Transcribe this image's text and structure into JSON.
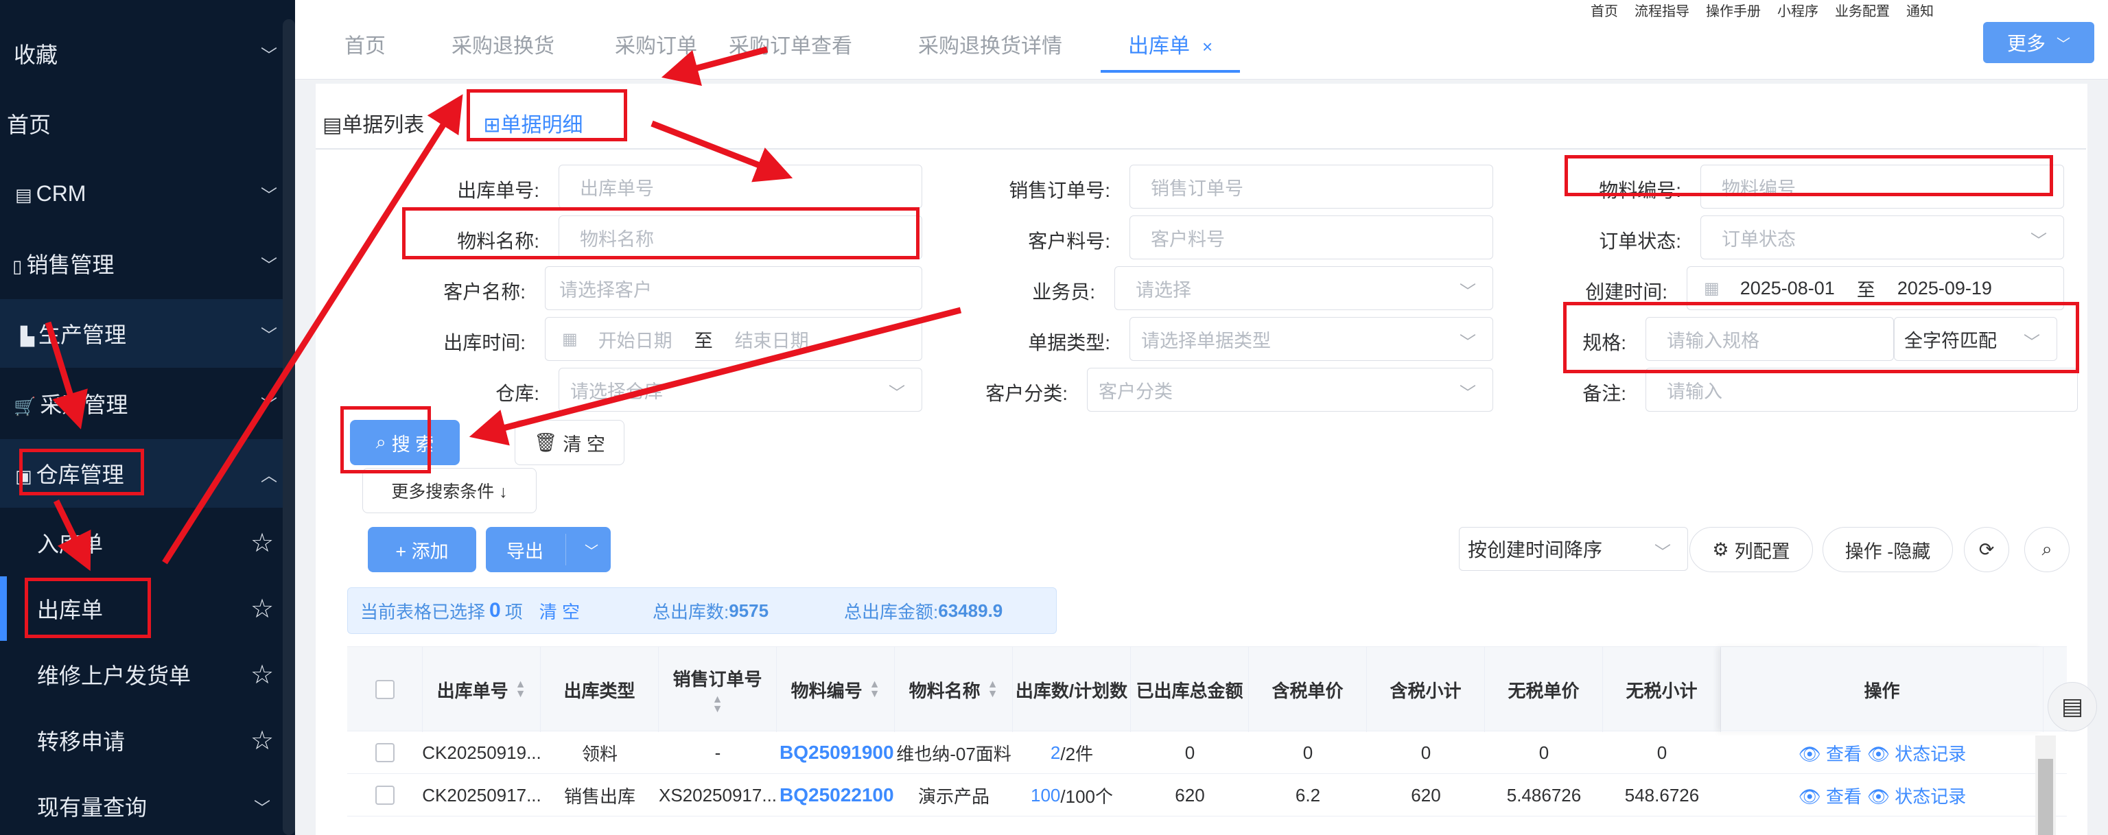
{
  "sidebar": {
    "menu": [
      {
        "label": "收藏",
        "icon": ""
      },
      {
        "label": "首页",
        "icon": ""
      },
      {
        "label": "CRM",
        "icon": "crm-icon"
      },
      {
        "label": "销售管理",
        "icon": "sales-icon"
      },
      {
        "label": "生产管理",
        "icon": "factory-icon"
      },
      {
        "label": "采购管理",
        "icon": "cart-icon"
      },
      {
        "label": "仓库管理",
        "icon": "warehouse-icon"
      }
    ],
    "sub": [
      {
        "label": "入库单"
      },
      {
        "label": "出库单"
      },
      {
        "label": "维修上户发货单"
      },
      {
        "label": "转移申请"
      },
      {
        "label": "现有量查询"
      }
    ]
  },
  "topbar": {
    "links": [
      "首页",
      "流程指导",
      "操作手册",
      "小程序",
      "业务配置",
      "通知"
    ],
    "tabs": [
      "首页",
      "采购退换货",
      "采购订单",
      "采购订单查看",
      "采购退换货详情",
      "出库单"
    ],
    "active_tab_close": "×",
    "more": "更多"
  },
  "subtabs": {
    "list": "单据列表",
    "detail": "单据明细"
  },
  "form": {
    "labels": {
      "out_no": "出库单号:",
      "so_no": "销售订单号:",
      "mat_code": "物料编号:",
      "mat_name": "物料名称:",
      "cust_part": "客户料号:",
      "order_status": "订单状态:",
      "cust_name": "客户名称:",
      "salesman": "业务员:",
      "created": "创建时间:",
      "out_time": "出库时间:",
      "doc_type": "单据类型:",
      "spec": "规格:",
      "warehouse": "仓库:",
      "cust_cat": "客户分类:",
      "remark": "备注:"
    },
    "placeholders": {
      "out_no": "出库单号",
      "so_no": "销售订单号",
      "mat_code": "物料编号",
      "mat_name": "物料名称",
      "cust_part": "客户料号",
      "order_status": "订单状态",
      "cust_name": "请选择客户",
      "salesman": "请选择",
      "out_start": "开始日期",
      "out_end": "结束日期",
      "doc_type": "请选择单据类型",
      "spec": "请输入规格",
      "warehouse": "请选择仓库",
      "cust_cat": "客户分类",
      "remark": "请输入"
    },
    "created_start": "2025-08-01",
    "created_end": "2025-09-19",
    "range_sep": "至",
    "spec_match": "全字符匹配"
  },
  "buttons": {
    "search": "搜 索",
    "clear": "清 空",
    "more_cond": "更多搜索条件 ↓",
    "add": "+ 添加",
    "export": "导出",
    "sort_select": "按创建时间降序",
    "col_config": "列配置",
    "ops_hide": "操作 -隐藏"
  },
  "summary": {
    "sel_prefix": "当前表格已选择",
    "sel_count": "0",
    "sel_suffix": "项",
    "clear": "清 空",
    "total_qty_label": "总出库数:",
    "total_qty": "9575",
    "total_amt_label": "总出库金额:",
    "total_amt": "63489.9"
  },
  "table": {
    "headers": [
      "出库单号",
      "出库类型",
      "销售订单号",
      "物料编号",
      "物料名称",
      "出库数/计划数",
      "已出库总金额",
      "含税单价",
      "含税小计",
      "无税单价",
      "无税小计",
      "操作"
    ],
    "rows": [
      {
        "out_no": "CK20250919...",
        "type": "领料",
        "so": "-",
        "code": "BQ25091900",
        "name": "维也纳-07面料",
        "qty_done": "2",
        "qty_plan": "/2件",
        "amount": "0",
        "tax_price": "0",
        "tax_sub": "0",
        "notax_price": "0",
        "notax_sub": "0",
        "op1": "查看",
        "op2": "状态记录"
      },
      {
        "out_no": "CK20250917...",
        "type": "销售出库",
        "so": "XS20250917...",
        "code": "BQ25022100",
        "name": "演示产品",
        "qty_done": "100",
        "qty_plan": "/100个",
        "amount": "620",
        "tax_price": "6.2",
        "tax_sub": "620",
        "notax_price": "5.486726",
        "notax_sub": "548.6726",
        "op1": "查看",
        "op2": "状态记录"
      }
    ]
  },
  "colors": {
    "primary": "#3d8bff",
    "button": "#5b9cf5",
    "sidebar": "#0b1a2e",
    "annotation": "#e8141f"
  }
}
